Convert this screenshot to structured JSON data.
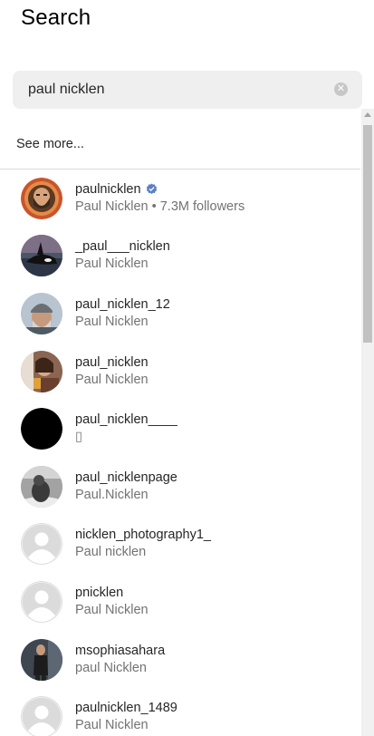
{
  "page": {
    "title": "Search"
  },
  "search": {
    "value": "paul nicklen",
    "clear_icon": "clear-circle-icon"
  },
  "see_more": "See more...",
  "results": [
    {
      "username": "paulnicklen",
      "subtitle": "Paul Nicklen • 7.3M followers",
      "verified": true,
      "avatar": "bearded-man-emblem"
    },
    {
      "username": "_paul___nicklen",
      "subtitle": "Paul Nicklen",
      "verified": false,
      "avatar": "orca"
    },
    {
      "username": "paul_nicklen_12",
      "subtitle": "Paul Nicklen",
      "verified": false,
      "avatar": "man-beanie"
    },
    {
      "username": "paul_nicklen",
      "subtitle": "Paul Nicklen",
      "verified": false,
      "avatar": "person-drink"
    },
    {
      "username": "paul_nicklen____",
      "subtitle": "▯",
      "verified": false,
      "avatar": "black"
    },
    {
      "username": "paul_nicklenpage",
      "subtitle": "Paul.Nicklen",
      "verified": false,
      "avatar": "seal-bw"
    },
    {
      "username": "nicklen_photography1_",
      "subtitle": "Paul nicklen",
      "verified": false,
      "avatar": "default"
    },
    {
      "username": "pnicklen",
      "subtitle": "Paul Nicklen",
      "verified": false,
      "avatar": "default"
    },
    {
      "username": "msophiasahara",
      "subtitle": "paul Nicklen",
      "verified": false,
      "avatar": "woman-dark"
    },
    {
      "username": "paulnicklen_1489",
      "subtitle": "Paul Nicklen",
      "verified": false,
      "avatar": "default"
    }
  ],
  "colors": {
    "search_bg": "#efefef",
    "secondary_text": "#737373",
    "verified_blue": "#5b7fc7",
    "divider": "#dbdbdb",
    "default_avatar": "#dbdbdb"
  }
}
